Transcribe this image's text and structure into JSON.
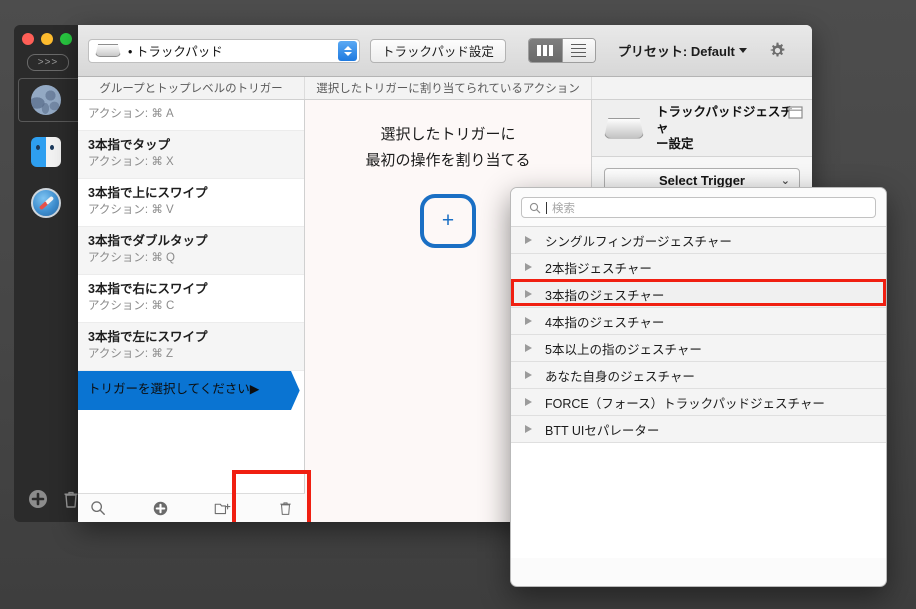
{
  "window": {
    "traffic_lights": [
      "close",
      "minimize",
      "zoom"
    ],
    "chevron_pill": ">>>",
    "dock_icons": [
      "globe-icon",
      "finder-icon",
      "safari-icon"
    ],
    "dock_add_label": "+",
    "dock_trash_label": "trash-icon"
  },
  "toolbar": {
    "device_value": "• トラックパッド",
    "trackpad_settings_label": "トラックパッド設定",
    "view_toggle": {
      "columns_label": "columns-view-icon",
      "list_label": "list-view-icon",
      "active": "columns"
    },
    "preset_label": "プリセット: Default",
    "gear_label": "gear-icon"
  },
  "columns": {
    "groups_header": "グループとトップレベルのトリガー",
    "actions_header": "選択したトリガーに割り当てられているアクション"
  },
  "triggers": [
    {
      "title": "",
      "action": "アクション: ⌘ A",
      "alt": false,
      "partial": true
    },
    {
      "title": "3本指でタップ",
      "action": "アクション: ⌘ X",
      "alt": true,
      "partial": false
    },
    {
      "title": "3本指で上にスワイプ",
      "action": "アクション: ⌘ V",
      "alt": false,
      "partial": false
    },
    {
      "title": "3本指でダブルタップ",
      "action": "アクション: ⌘ Q",
      "alt": true,
      "partial": false
    },
    {
      "title": "3本指で右にスワイプ",
      "action": "アクション: ⌘ C",
      "alt": false,
      "partial": false
    },
    {
      "title": "3本指で左にスワイプ",
      "action": "アクション: ⌘ Z",
      "alt": true,
      "partial": false
    }
  ],
  "selected_trigger": {
    "label": "トリガーを選択してください▶",
    "color": "#0a74d2"
  },
  "add_trigger": {
    "plus_label": "+",
    "highlight_color": "#f01f11"
  },
  "center": {
    "line1": "選択したトリガーに",
    "line2": "最初の操作を割り当てる",
    "plus_label": "+",
    "accent_color": "#1a6fc4"
  },
  "right_pane": {
    "device_name_line1": "トラックパッドジェスチャ",
    "device_name_line2": "ー設定",
    "select_trigger_label": "Select Trigger",
    "chevron": "⌄",
    "window_badge": "window-icon"
  },
  "bottom_toolbar": {
    "search_label": "search-icon",
    "add_label": "add-circle-icon",
    "new_folder_label": "new-folder-icon",
    "delete_label": "trash-icon"
  },
  "picker": {
    "search_placeholder": "検索",
    "search_value": "",
    "rows": [
      {
        "label": "シングルフィンガージェスチャー",
        "highlighted": false
      },
      {
        "label": "2本指ジェスチャー",
        "highlighted": false
      },
      {
        "label": "3本指のジェスチャー",
        "highlighted": true
      },
      {
        "label": "4本指のジェスチャー",
        "highlighted": false
      },
      {
        "label": "5本以上の指のジェスチャー",
        "highlighted": false
      },
      {
        "label": "あなた自身のジェスチャー",
        "highlighted": false
      },
      {
        "label": "FORCE（フォース）トラックパッドジェスチャー",
        "highlighted": false
      },
      {
        "label": "BTT UIセパレーター",
        "highlighted": false
      }
    ],
    "highlight_color": "#f01f11"
  }
}
